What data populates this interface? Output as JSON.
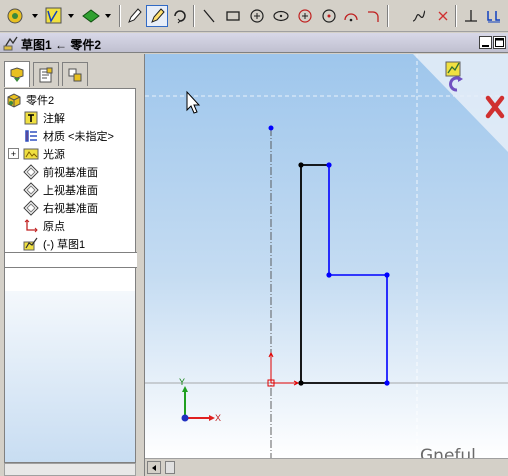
{
  "toolbar": {
    "icons": [
      "smart-dimension-icon",
      "sketch-relation-icon",
      "display-style-icon",
      "sketch-pencil-icon",
      "rapid-sketch-icon",
      "rotate-icon",
      "line-icon",
      "rectangle-icon",
      "circle-icon",
      "ellipse-icon",
      "tangent-arc-icon",
      "three-point-arc-icon",
      "centerpoint-arc-icon",
      "spline-icon",
      "delete-icon",
      "perpendicular-icon",
      "exit-sketch-icon"
    ]
  },
  "window": {
    "title": "草图1 ← 零件2"
  },
  "tree": {
    "root": "零件2",
    "items": [
      {
        "label": "注解",
        "icon": "annotation-icon"
      },
      {
        "label": "材质 <未指定>",
        "icon": "material-icon"
      },
      {
        "label": "光源",
        "icon": "lights-icon",
        "expandable": true
      },
      {
        "label": "前视基准面",
        "icon": "plane-icon"
      },
      {
        "label": "上视基准面",
        "icon": "plane-icon"
      },
      {
        "label": "右视基准面",
        "icon": "plane-icon"
      },
      {
        "label": "原点",
        "icon": "origin-icon"
      },
      {
        "label": "(-) 草图1",
        "icon": "sketch-icon"
      }
    ]
  },
  "canvas": {
    "axis_labels": {
      "x": "X",
      "y": "Y"
    },
    "watermark": "Gneful"
  },
  "colors": {
    "sketch_black": "#000000",
    "sketch_blue": "#0000ff",
    "origin_red": "#e00000",
    "exit_red": "#d03030"
  }
}
